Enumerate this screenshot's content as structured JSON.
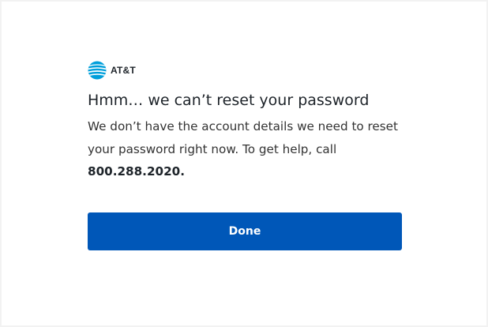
{
  "brand": {
    "name": "AT&T",
    "logo_icon": "att-globe-icon",
    "color": "#009fdb"
  },
  "dialog": {
    "title": "Hmm… we can’t reset your password",
    "message": "We don’t have the account details we need to reset your password right now. To get help, call ",
    "phone": "800.288.2020",
    "phone_suffix": ".",
    "done_label": "Done"
  },
  "colors": {
    "primary_button": "#0057b8",
    "text": "#1d2329"
  }
}
